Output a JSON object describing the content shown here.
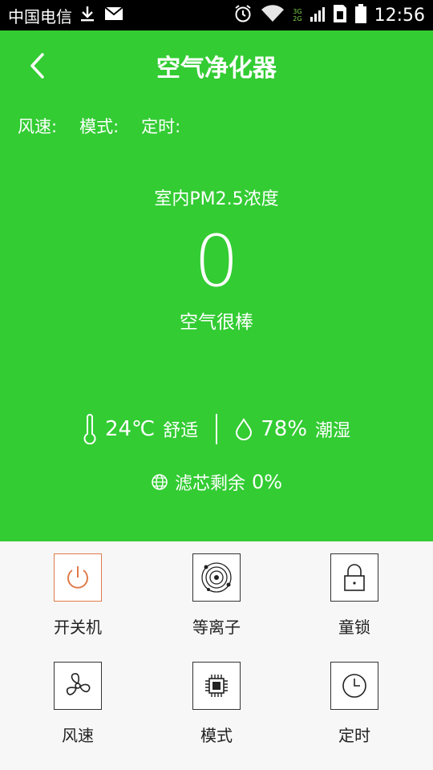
{
  "statusbar": {
    "carrier": "中国电信",
    "net_3g": "3G",
    "net_2g": "2G",
    "time": "12:56"
  },
  "header": {
    "title": "空气净化器"
  },
  "info": {
    "wind_speed_label": "风速:",
    "mode_label": "模式:",
    "timer_label": "定时:"
  },
  "pm": {
    "label": "室内PM2.5浓度",
    "value": "0",
    "status": "空气很棒"
  },
  "env": {
    "temperature": "24℃",
    "temperature_status": "舒适",
    "humidity": "78%",
    "humidity_status": "潮湿",
    "filter_label": "滤芯剩余",
    "filter_value": "0%"
  },
  "controls": {
    "power": "开关机",
    "ion": "等离子",
    "child_lock": "童锁",
    "wind_speed": "风速",
    "mode": "模式",
    "timer": "定时"
  },
  "colors": {
    "accent": "#33cc33",
    "power_active": "#e07a4a"
  }
}
